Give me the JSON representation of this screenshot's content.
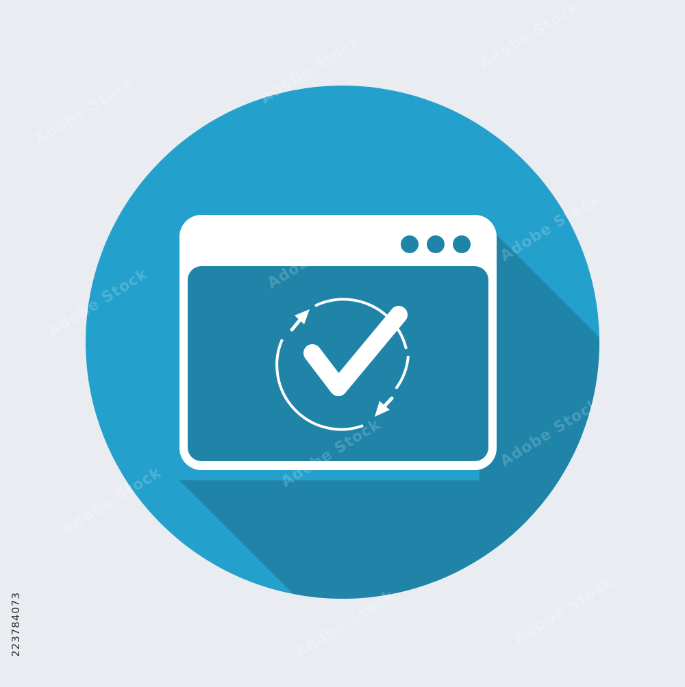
{
  "icon": {
    "name": "app-window-verified-refresh-icon",
    "circle_color": "#24a0cc",
    "shadow_color": "#1f84a8",
    "window_color": "#ffffff",
    "window_content_color": "#1f84a8",
    "dot_count": 3
  },
  "watermark": {
    "text": "Adobe Stock"
  },
  "stock_id": "223784073"
}
